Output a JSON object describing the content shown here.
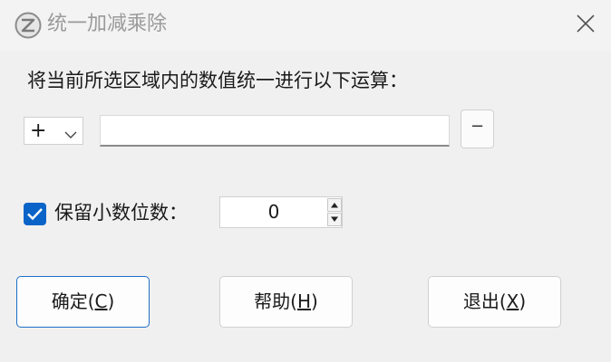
{
  "window": {
    "title": "统一加减乘除"
  },
  "prompt": "将当前所选区域内的数值统一进行以下运算：",
  "operator": {
    "selected": "+",
    "value": ""
  },
  "minus_button": "−",
  "keep_decimals": {
    "checked": true,
    "label": "保留小数位数：",
    "value": "0"
  },
  "buttons": {
    "ok": {
      "text": "确定(",
      "mnemonic": "C",
      "close": ")"
    },
    "help": {
      "text": "帮助(",
      "mnemonic": "H",
      "close": ")"
    },
    "exit": {
      "text": "退出(",
      "mnemonic": "X",
      "close": ")"
    }
  },
  "colors": {
    "accent": "#0a64c8",
    "background": "#f0f0f0"
  }
}
